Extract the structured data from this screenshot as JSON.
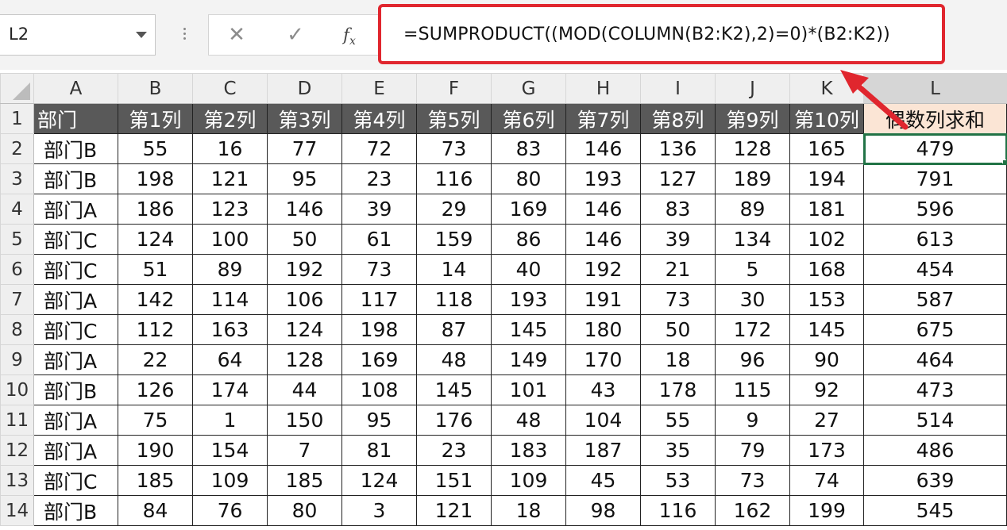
{
  "name_box": {
    "value": "L2"
  },
  "formula_bar": {
    "cancel_glyph": "✕",
    "enter_glyph": "✓",
    "fx_label": "f",
    "fx_sub": "x",
    "formula": "=SUMPRODUCT((MOD(COLUMN(B2:K2),2)=0)*(B2:K2))"
  },
  "columns": [
    "A",
    "B",
    "C",
    "D",
    "E",
    "F",
    "G",
    "H",
    "I",
    "J",
    "K",
    "L"
  ],
  "header_row": {
    "num": "1",
    "cells": [
      "部门",
      "第1列",
      "第2列",
      "第3列",
      "第4列",
      "第5列",
      "第6列",
      "第7列",
      "第8列",
      "第9列",
      "第10列",
      "偶数列求和"
    ]
  },
  "rows": [
    {
      "num": "2",
      "cells": [
        "部门B",
        "55",
        "16",
        "77",
        "72",
        "73",
        "83",
        "146",
        "136",
        "128",
        "165",
        "479"
      ]
    },
    {
      "num": "3",
      "cells": [
        "部门B",
        "198",
        "121",
        "95",
        "23",
        "116",
        "80",
        "193",
        "127",
        "189",
        "194",
        "791"
      ]
    },
    {
      "num": "4",
      "cells": [
        "部门A",
        "186",
        "123",
        "146",
        "39",
        "29",
        "169",
        "146",
        "83",
        "89",
        "181",
        "596"
      ]
    },
    {
      "num": "5",
      "cells": [
        "部门C",
        "124",
        "100",
        "50",
        "61",
        "159",
        "86",
        "146",
        "39",
        "134",
        "102",
        "613"
      ]
    },
    {
      "num": "6",
      "cells": [
        "部门C",
        "51",
        "89",
        "192",
        "73",
        "14",
        "40",
        "192",
        "21",
        "5",
        "168",
        "454"
      ]
    },
    {
      "num": "7",
      "cells": [
        "部门A",
        "142",
        "114",
        "106",
        "117",
        "118",
        "193",
        "191",
        "73",
        "30",
        "153",
        "587"
      ]
    },
    {
      "num": "8",
      "cells": [
        "部门C",
        "112",
        "163",
        "124",
        "198",
        "87",
        "145",
        "180",
        "50",
        "172",
        "145",
        "675"
      ]
    },
    {
      "num": "9",
      "cells": [
        "部门A",
        "22",
        "64",
        "128",
        "169",
        "48",
        "149",
        "170",
        "18",
        "96",
        "90",
        "464"
      ]
    },
    {
      "num": "10",
      "cells": [
        "部门B",
        "126",
        "174",
        "44",
        "108",
        "145",
        "101",
        "43",
        "178",
        "115",
        "92",
        "473"
      ]
    },
    {
      "num": "11",
      "cells": [
        "部门A",
        "75",
        "1",
        "150",
        "95",
        "176",
        "48",
        "104",
        "55",
        "9",
        "27",
        "514"
      ]
    },
    {
      "num": "12",
      "cells": [
        "部门A",
        "190",
        "154",
        "7",
        "81",
        "23",
        "183",
        "187",
        "35",
        "79",
        "173",
        "486"
      ]
    },
    {
      "num": "13",
      "cells": [
        "部门C",
        "185",
        "109",
        "185",
        "124",
        "151",
        "109",
        "45",
        "53",
        "73",
        "74",
        "639"
      ]
    },
    {
      "num": "14",
      "cells": [
        "部门B",
        "84",
        "76",
        "80",
        "3",
        "121",
        "18",
        "98",
        "116",
        "162",
        "199",
        "545"
      ]
    }
  ],
  "colors": {
    "highlight": "#e0262e",
    "selection": "#217346",
    "header_fill": "#595959",
    "result_header_fill": "#fbe5d5"
  }
}
